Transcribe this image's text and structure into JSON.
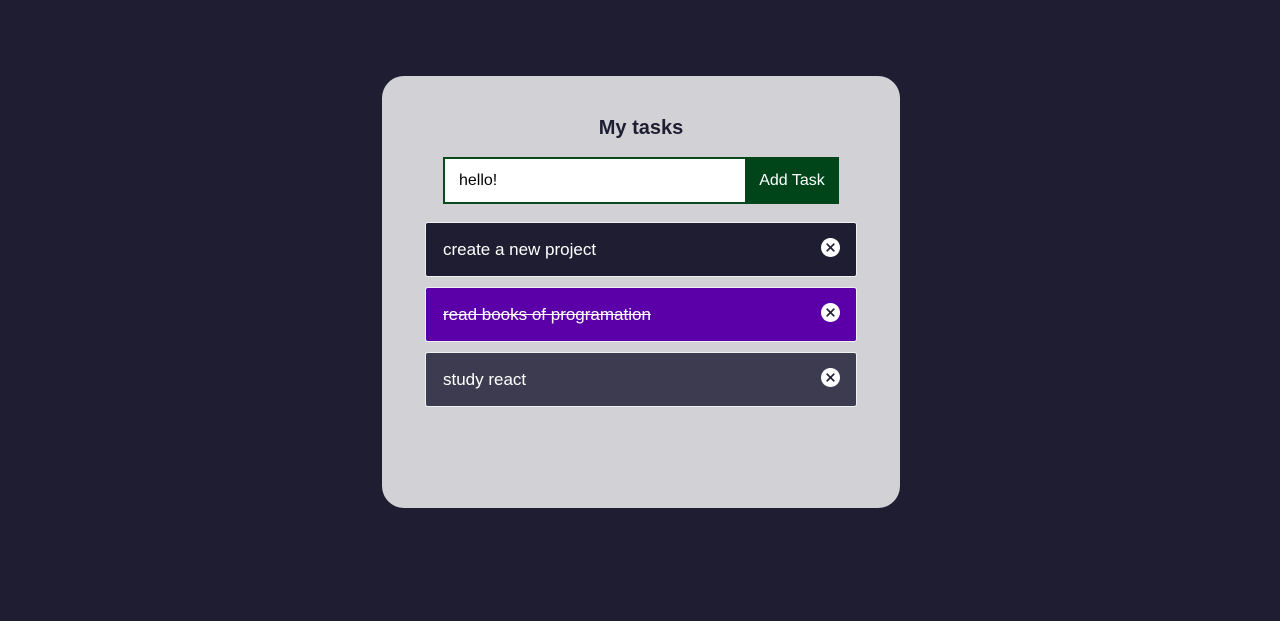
{
  "app": {
    "title": "My tasks"
  },
  "form": {
    "input_value": "hello!",
    "add_label": "Add Task"
  },
  "tasks": [
    {
      "text": "create a new project",
      "completed": false,
      "color": "#1e1d31"
    },
    {
      "text": "read books of programation",
      "completed": true,
      "color": "#5b00a8"
    },
    {
      "text": "study react",
      "completed": false,
      "color": "#3c3b4f"
    }
  ],
  "icons": {
    "remove": "close-circle-icon"
  },
  "colors": {
    "background": "#1e1d31",
    "card": "#d2d1d6",
    "button": "#00451a"
  }
}
